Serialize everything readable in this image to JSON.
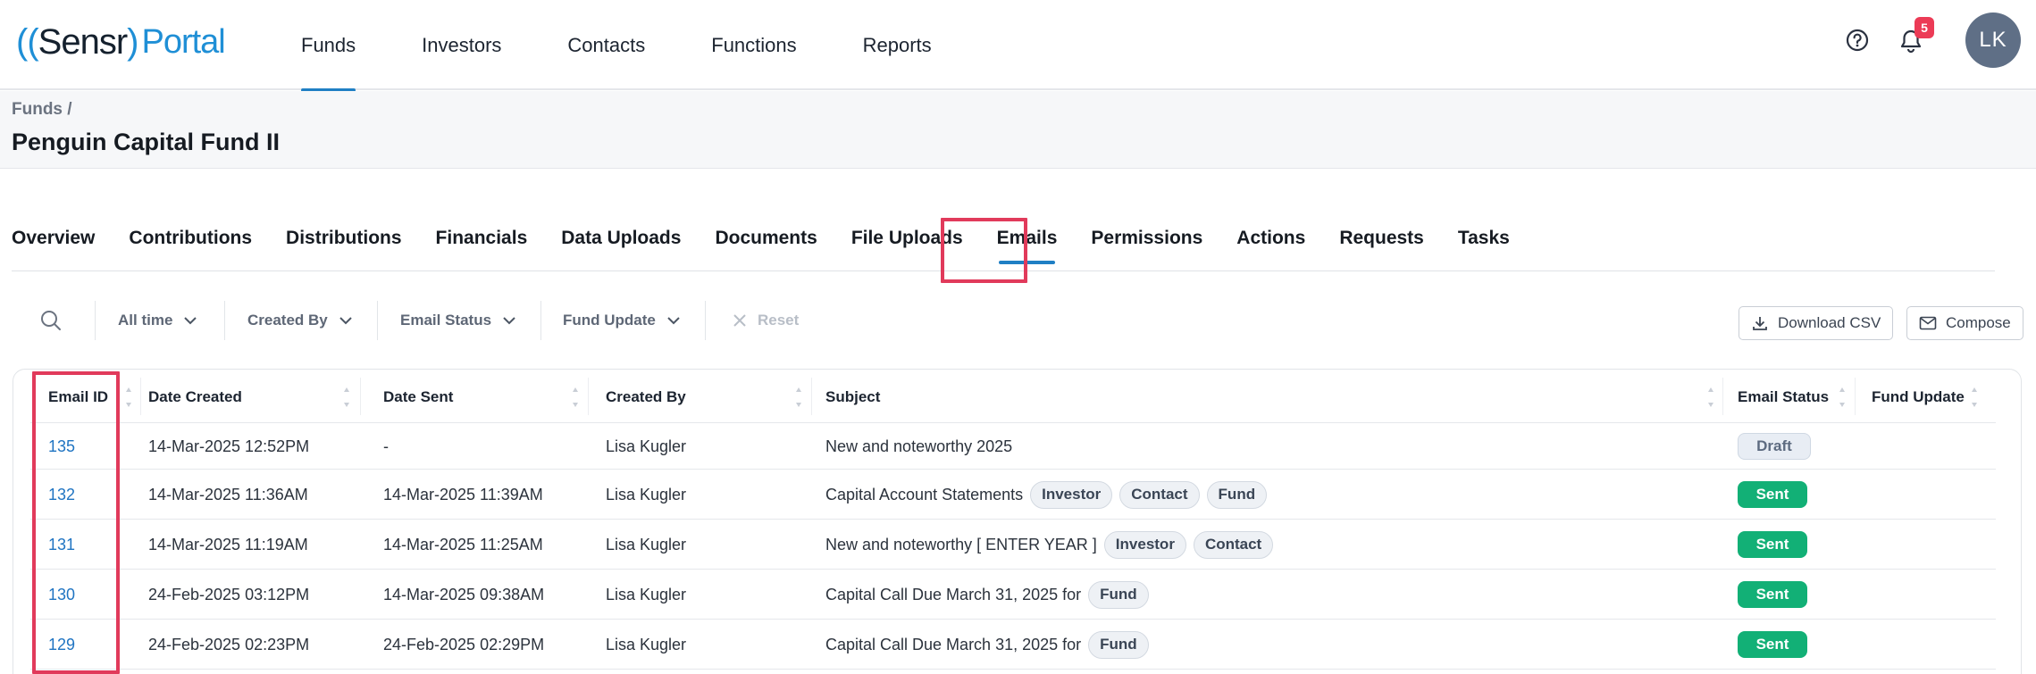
{
  "brand": {
    "open": "((",
    "name": "Sensr",
    "close": ")",
    "product": "Portal"
  },
  "nav": {
    "items": [
      "Funds",
      "Investors",
      "Contacts",
      "Functions",
      "Reports"
    ],
    "active": "Funds"
  },
  "header_icons": {
    "help": "help-circle-icon",
    "notifications": "bell-icon",
    "notification_count": "5",
    "avatar_initials": "LK"
  },
  "breadcrumb": "Funds /",
  "page_title": "Penguin Capital Fund II",
  "tabs": {
    "items": [
      "Overview",
      "Contributions",
      "Distributions",
      "Financials",
      "Data Uploads",
      "Documents",
      "File Uploads",
      "Emails",
      "Permissions",
      "Actions",
      "Requests",
      "Tasks"
    ],
    "active": "Emails"
  },
  "toolbar": {
    "filters": [
      "All time",
      "Created By",
      "Email Status",
      "Fund Update"
    ],
    "reset": "Reset",
    "download_csv": "Download CSV",
    "compose": "Compose"
  },
  "table": {
    "columns": [
      "Email ID",
      "Date Created",
      "Date Sent",
      "Created By",
      "Subject",
      "Email Status",
      "Fund Update"
    ],
    "rows": [
      {
        "id": "135",
        "created": "14-Mar-2025 12:52PM",
        "sent": "-",
        "by": "Lisa Kugler",
        "subject": "New and noteworthy 2025",
        "tags": [],
        "status": "Draft"
      },
      {
        "id": "132",
        "created": "14-Mar-2025 11:36AM",
        "sent": "14-Mar-2025 11:39AM",
        "by": "Lisa Kugler",
        "subject": "Capital Account Statements",
        "tags": [
          "Investor",
          "Contact",
          "Fund"
        ],
        "status": "Sent"
      },
      {
        "id": "131",
        "created": "14-Mar-2025 11:19AM",
        "sent": "14-Mar-2025 11:25AM",
        "by": "Lisa Kugler",
        "subject": "New and noteworthy [ ENTER YEAR ]",
        "tags": [
          "Investor",
          "Contact"
        ],
        "status": "Sent"
      },
      {
        "id": "130",
        "created": "24-Feb-2025 03:12PM",
        "sent": "14-Mar-2025 09:38AM",
        "by": "Lisa Kugler",
        "subject": "Capital Call Due March 31, 2025 for",
        "tags": [
          "Fund"
        ],
        "status": "Sent"
      },
      {
        "id": "129",
        "created": "24-Feb-2025 02:23PM",
        "sent": "24-Feb-2025 02:29PM",
        "by": "Lisa Kugler",
        "subject": "Capital Call Due March 31, 2025 for",
        "tags": [
          "Fund"
        ],
        "status": "Sent"
      }
    ]
  },
  "colors": {
    "accent": "#1f7fc4",
    "highlight": "#e13a5b",
    "sent": "#12b076",
    "badge": "#ec3b56"
  }
}
